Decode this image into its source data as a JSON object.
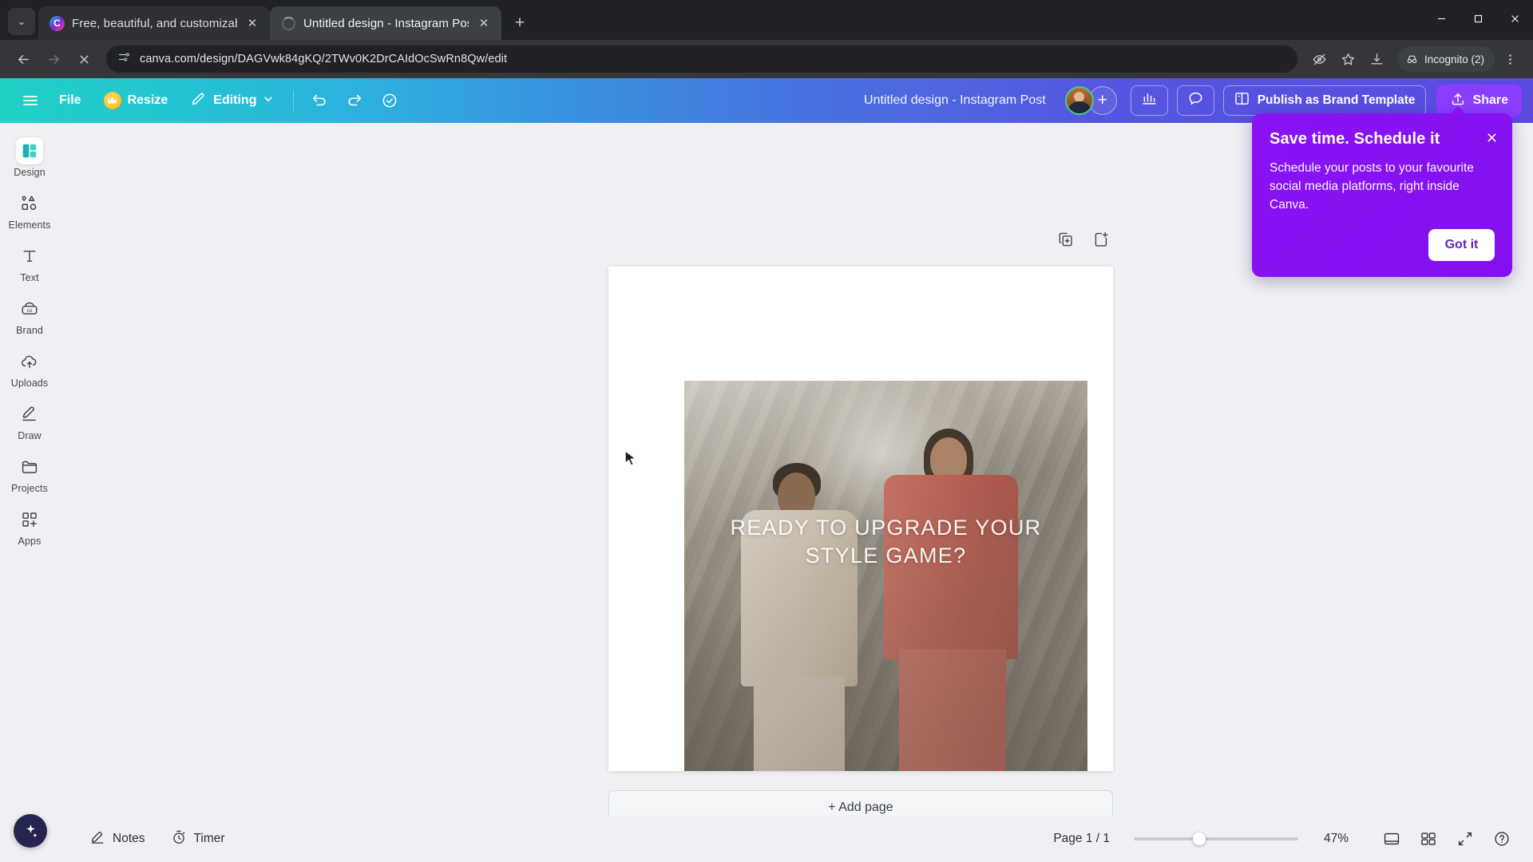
{
  "browser": {
    "tabs": [
      {
        "title": "Free, beautiful, and customizab",
        "favicon": "canva-logo-icon",
        "active": false
      },
      {
        "title": "Untitled design - Instagram Pos",
        "favicon": "loading-spinner-icon",
        "active": true
      }
    ],
    "new_tab_label": "+",
    "tab_list_label": "⌄",
    "window_controls": {
      "minimize": "—",
      "maximize": "❐",
      "close": "✕"
    },
    "nav": {
      "back": "←",
      "forward": "→",
      "stop": "✕"
    },
    "omnibox": {
      "url": "canva.com/design/DAGVwk84gKQ/2TWv0K2DrCAIdOcSwRn8Qw/edit",
      "site_info_icon": "site-settings-icon"
    },
    "toolbar_right": {
      "extension_label": "eye-off-icon",
      "bookmark_label": "star-icon",
      "download_label": "download-icon",
      "incognito_label": "Incognito (2)",
      "menu_label": "⋮"
    }
  },
  "canva": {
    "topbar": {
      "menu_icon": "hamburger-menu-icon",
      "file_label": "File",
      "resize_label": "Resize",
      "resize_badge": "crown-icon",
      "editing_label": "Editing",
      "editing_chevron": "⌄",
      "undo_label": "undo-icon",
      "redo_label": "redo-icon",
      "cloud_status_label": "saved-cloud-icon",
      "design_title": "Untitled design - Instagram Post",
      "avatar_label": "user-avatar",
      "add_collaborator_label": "+",
      "analytics_label": "analytics-icon",
      "comment_label": "comment-icon",
      "publish_template_label": "Publish as Brand Template",
      "publish_template_icon": "brand-template-icon",
      "share_label": "Share",
      "share_icon": "share-upload-icon"
    },
    "sidebar": {
      "items": [
        {
          "label": "Design",
          "icon": "design-icon",
          "active": true
        },
        {
          "label": "Elements",
          "icon": "elements-icon",
          "active": false
        },
        {
          "label": "Text",
          "icon": "text-icon",
          "active": false
        },
        {
          "label": "Brand",
          "icon": "brand-icon",
          "active": false
        },
        {
          "label": "Uploads",
          "icon": "uploads-icon",
          "active": false
        },
        {
          "label": "Draw",
          "icon": "draw-icon",
          "active": false
        },
        {
          "label": "Projects",
          "icon": "projects-icon",
          "active": false
        },
        {
          "label": "Apps",
          "icon": "apps-icon",
          "active": false
        }
      ],
      "magic_button_label": "magic-studio-icon"
    },
    "canvas": {
      "duplicate_page_label": "duplicate-page-icon",
      "add_page_tool_label": "add-page-icon",
      "add_page_button": "+ Add page",
      "design_text": "READY TO UPGRADE YOUR STYLE GAME?"
    },
    "bottombar": {
      "notes_label": "Notes",
      "notes_icon": "notes-icon",
      "timer_label": "Timer",
      "timer_icon": "timer-icon",
      "page_indicator": "Page 1 / 1",
      "zoom_percent": "47%",
      "zoom_value": 47,
      "grid_view_label": "grid-view-icon",
      "page_view_label": "page-view-icon",
      "fullscreen_label": "fullscreen-icon",
      "help_label": "?"
    },
    "popup": {
      "title": "Save time. Schedule it",
      "body": "Schedule your posts to your favourite social media platforms, right inside Canva.",
      "cta_label": "Got it",
      "close_label": "✕"
    },
    "colors": {
      "topbar_start": "#1fd1c4",
      "topbar_end": "#5a4ae0",
      "share_button": "#8b3dff",
      "popup_background": "#8a13f5",
      "active_rail": "#00c4cc"
    }
  }
}
